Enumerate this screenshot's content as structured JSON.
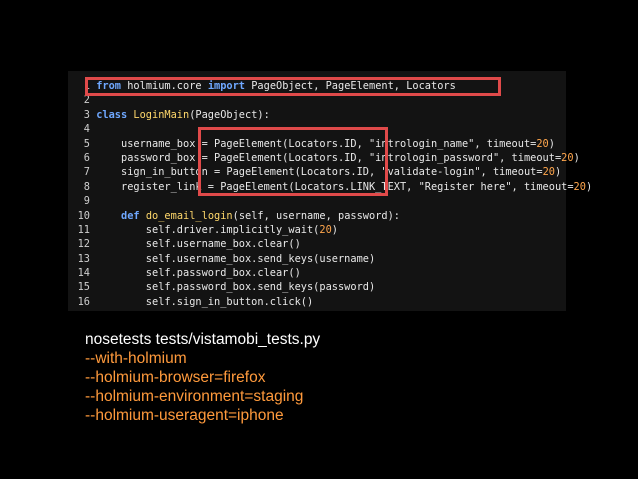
{
  "colors": {
    "background": "#000000",
    "code_panel": "#131313",
    "highlight_box": "#e04a4a",
    "keyword": "#6fa8ff",
    "identifier": "#ffd86b",
    "number": "#ffa64d",
    "text": "#e8e8e8",
    "command": "#ffffff",
    "argument": "#ff9a3c"
  },
  "code": {
    "lines": [
      {
        "num": "1",
        "parts": [
          {
            "t": "from",
            "c": "kw"
          },
          {
            "t": " holmium.core ",
            "c": "plain"
          },
          {
            "t": "import",
            "c": "kw"
          },
          {
            "t": " PageObject, PageElement, Locators",
            "c": "plain"
          }
        ]
      },
      {
        "num": "2",
        "parts": []
      },
      {
        "num": "3",
        "parts": [
          {
            "t": "class",
            "c": "kw"
          },
          {
            "t": " ",
            "c": "plain"
          },
          {
            "t": "LoginMain",
            "c": "cls"
          },
          {
            "t": "(PageObject):",
            "c": "plain"
          }
        ]
      },
      {
        "num": "4",
        "parts": []
      },
      {
        "num": "5",
        "parts": [
          {
            "t": "    username_box = PageElement(Locators.ID, \"intrologin_name\", timeout=",
            "c": "plain"
          },
          {
            "t": "20",
            "c": "num"
          },
          {
            "t": ")",
            "c": "plain"
          }
        ]
      },
      {
        "num": "6",
        "parts": [
          {
            "t": "    password_box = PageElement(Locators.ID, \"intrologin_password\", timeout=",
            "c": "plain"
          },
          {
            "t": "20",
            "c": "num"
          },
          {
            "t": ")",
            "c": "plain"
          }
        ]
      },
      {
        "num": "7",
        "parts": [
          {
            "t": "    sign_in_button = PageElement(Locators.ID, \"validate-login\", timeout=",
            "c": "plain"
          },
          {
            "t": "20",
            "c": "num"
          },
          {
            "t": ")",
            "c": "plain"
          }
        ]
      },
      {
        "num": "8",
        "parts": [
          {
            "t": "    register_link = PageElement(Locators.LINK_TEXT, \"Register here\", timeout=",
            "c": "plain"
          },
          {
            "t": "20",
            "c": "num"
          },
          {
            "t": ")",
            "c": "plain"
          }
        ]
      },
      {
        "num": "9",
        "parts": []
      },
      {
        "num": "10",
        "parts": [
          {
            "t": "    ",
            "c": "plain"
          },
          {
            "t": "def",
            "c": "kw"
          },
          {
            "t": " ",
            "c": "plain"
          },
          {
            "t": "do_email_login",
            "c": "fn"
          },
          {
            "t": "(self, username, password):",
            "c": "plain"
          }
        ]
      },
      {
        "num": "11",
        "parts": [
          {
            "t": "        self.driver.implicitly_wait(",
            "c": "plain"
          },
          {
            "t": "20",
            "c": "num"
          },
          {
            "t": ")",
            "c": "plain"
          }
        ]
      },
      {
        "num": "12",
        "parts": [
          {
            "t": "        self.username_box.clear()",
            "c": "plain"
          }
        ]
      },
      {
        "num": "13",
        "parts": [
          {
            "t": "        self.username_box.send_keys(username)",
            "c": "plain"
          }
        ]
      },
      {
        "num": "14",
        "parts": [
          {
            "t": "        self.password_box.clear()",
            "c": "plain"
          }
        ]
      },
      {
        "num": "15",
        "parts": [
          {
            "t": "        self.password_box.send_keys(password)",
            "c": "plain"
          }
        ]
      },
      {
        "num": "16",
        "parts": [
          {
            "t": "        self.sign_in_button.click()",
            "c": "plain"
          }
        ]
      }
    ]
  },
  "terminal": {
    "command": "nosetests tests/vistamobi_tests.py",
    "args": [
      "--with-holmium",
      "--holmium-browser=firefox",
      "--holmium-environment=staging",
      "--holmium-useragent=iphone"
    ]
  }
}
